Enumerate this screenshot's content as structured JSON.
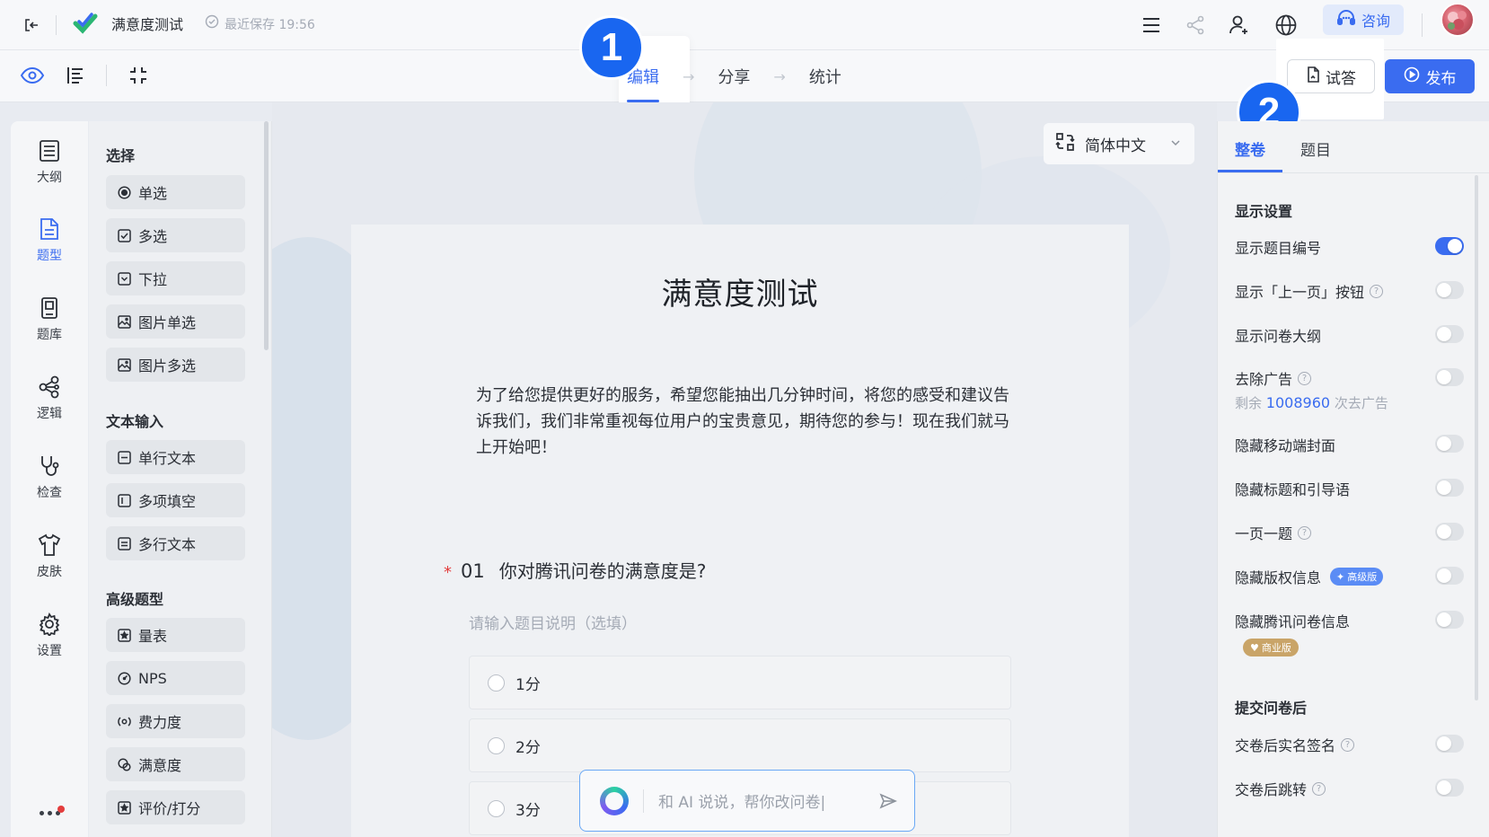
{
  "header": {
    "title": "满意度测试",
    "saved_text": "最近保存 19:56",
    "consult_label": "咨询"
  },
  "subbar": {
    "steps": [
      "编辑",
      "分享",
      "统计"
    ],
    "try_label": "试答",
    "publish_label": "发布"
  },
  "badges": [
    "1",
    "2"
  ],
  "rail": {
    "items": [
      "大纲",
      "题型",
      "题库",
      "逻辑",
      "检查",
      "皮肤",
      "设置"
    ]
  },
  "palette": {
    "group_select": "选择",
    "select_items": [
      "单选",
      "多选",
      "下拉",
      "图片单选",
      "图片多选"
    ],
    "group_text": "文本输入",
    "text_items": [
      "单行文本",
      "多项填空",
      "多行文本"
    ],
    "group_advanced": "高级题型",
    "advanced_items": [
      "量表",
      "NPS",
      "费力度",
      "满意度",
      "评价/打分"
    ]
  },
  "language": {
    "selected": "简体中文"
  },
  "survey": {
    "title": "满意度测试",
    "description": "为了给您提供更好的服务，希望您能抽出几分钟时间，将您的感受和建议告诉我们，我们非常重视每位用户的宝贵意见，期待您的参与！现在我们就马上开始吧！",
    "question": {
      "required_mark": "*",
      "number": "01",
      "text": "你对腾讯问卷的满意度是?",
      "sub_placeholder": "请输入题目说明（选填）",
      "options": [
        "1分",
        "2分",
        "3分"
      ]
    }
  },
  "ai": {
    "placeholder": "和 AI 说说，帮你改问卷|"
  },
  "right_panel": {
    "tabs": [
      "整卷",
      "题目"
    ],
    "section_display": "显示设置",
    "rows": [
      {
        "label": "显示题目编号",
        "on": true
      },
      {
        "label": "显示「上一页」按钮",
        "on": false
      },
      {
        "label": "显示问卷大纲",
        "on": false
      },
      {
        "label": "去除广告",
        "on": false
      },
      {
        "label": "隐藏移动端封面",
        "on": false
      },
      {
        "label": "隐藏标题和引导语",
        "on": false
      },
      {
        "label": "一页一题",
        "on": false
      },
      {
        "label": "隐藏版权信息",
        "on": false
      },
      {
        "label": "隐藏腾讯问卷信息",
        "on": false
      }
    ],
    "ads_note_prefix": "剩余",
    "ads_count": "1008960",
    "ads_note_suffix": "次去广告",
    "tag_pro": "高级版",
    "tag_biz": "商业版",
    "section_submit": "提交问卷后",
    "submit_rows": [
      {
        "label": "交卷后实名签名",
        "on": false
      },
      {
        "label": "交卷后跳转",
        "on": false
      }
    ]
  },
  "colors": {
    "accent": "#3a6cf0",
    "badge": "#1966f0"
  }
}
